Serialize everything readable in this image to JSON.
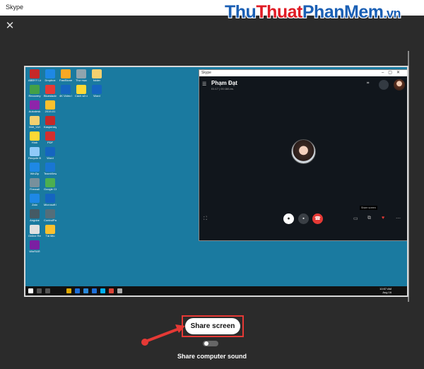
{
  "window": {
    "title": "Skype"
  },
  "watermark": {
    "part1": "Thu",
    "part2": "Thuat",
    "part3": "PhanMem",
    "part4": ".vn"
  },
  "controls": {
    "close_icon": "close-icon"
  },
  "preview": {
    "desktop_icons": [
      {
        "label": "ABBYY Lingvo"
      },
      {
        "label": "Dropbox"
      },
      {
        "label": "FastStone"
      },
      {
        "label": "Thư mục"
      },
      {
        "label": "folder"
      },
      {
        "label": "Recovery"
      },
      {
        "label": "Bluestacks"
      },
      {
        "label": "4K Video Downloader"
      },
      {
        "label": "Cách sử dụng"
      },
      {
        "label": "Word"
      },
      {
        "label": "Autodesk"
      },
      {
        "label": "2019-01"
      },
      {
        "label": "Mới_Vợt"
      },
      {
        "label": "Kaspersky"
      },
      {
        "label": "Hình"
      },
      {
        "label": "PDF"
      },
      {
        "label": "Recycle Bin"
      },
      {
        "label": "Word"
      },
      {
        "label": "WinZip"
      },
      {
        "label": "TeamViewer"
      },
      {
        "label": "Firewall"
      },
      {
        "label": "Google Chrome"
      },
      {
        "label": "Zalo"
      },
      {
        "label": "Microsoft Edge"
      },
      {
        "label": "Angular"
      },
      {
        "label": "ControlPanel"
      },
      {
        "label": "Online Remote"
      },
      {
        "label": "Tài liệu"
      },
      {
        "label": "WinRAR"
      }
    ],
    "taskbar": {
      "time": "10:57 AM",
      "date": "Aug 16"
    },
    "skype_call": {
      "window_title": "Skype",
      "contact_name": "Phạm Đạt",
      "duration": "01:17 | 00:18/Lbs.",
      "tooltip": "Share screen"
    }
  },
  "share_button": {
    "label": "Share screen"
  },
  "sound_toggle": {
    "label": "Share computer sound",
    "state": "off"
  },
  "colors": {
    "accent_red": "#e53935",
    "desktop_bg": "#1a7aa0",
    "end_call": "#e53935"
  }
}
